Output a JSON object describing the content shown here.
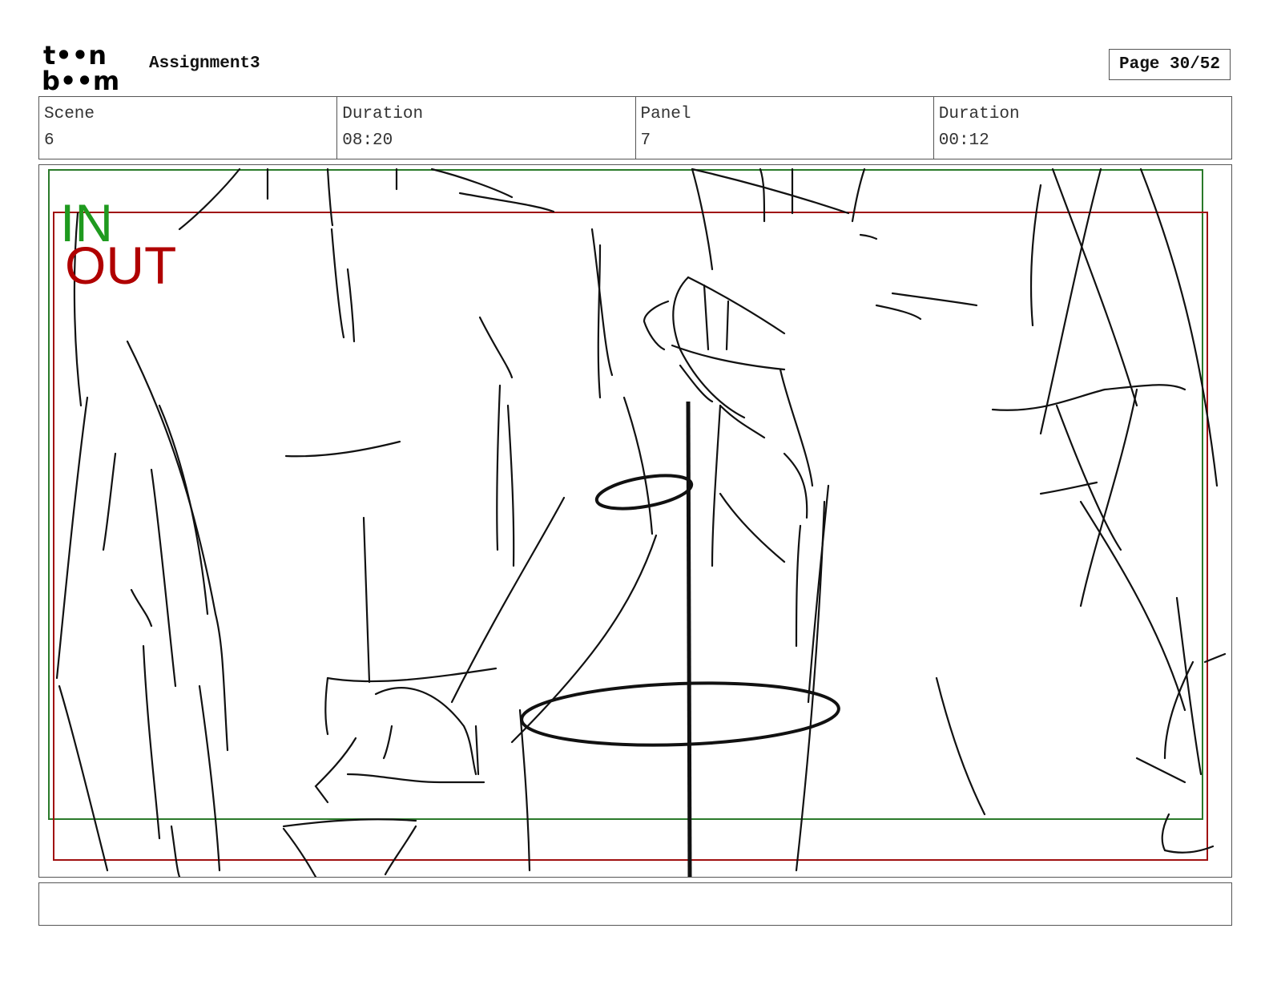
{
  "header": {
    "logo": {
      "icon": "toon-boom-logo",
      "line1": "t••n",
      "line2": "b••m"
    },
    "project_title": "Assignment3",
    "page_label": "Page 30/52"
  },
  "info": {
    "scene_label": "Scene",
    "scene_value": "6",
    "scene_duration_label": "Duration",
    "scene_duration_value": "08:20",
    "panel_label": "Panel",
    "panel_value": "7",
    "panel_duration_label": "Duration",
    "panel_duration_value": "00:12"
  },
  "panel": {
    "drawing": "storyboard-sketch",
    "in_label": "IN",
    "out_label": "OUT",
    "colors": {
      "in": "#1f9a1f",
      "out": "#b00000",
      "sketch": "#111111"
    }
  },
  "caption": {
    "text": ""
  }
}
